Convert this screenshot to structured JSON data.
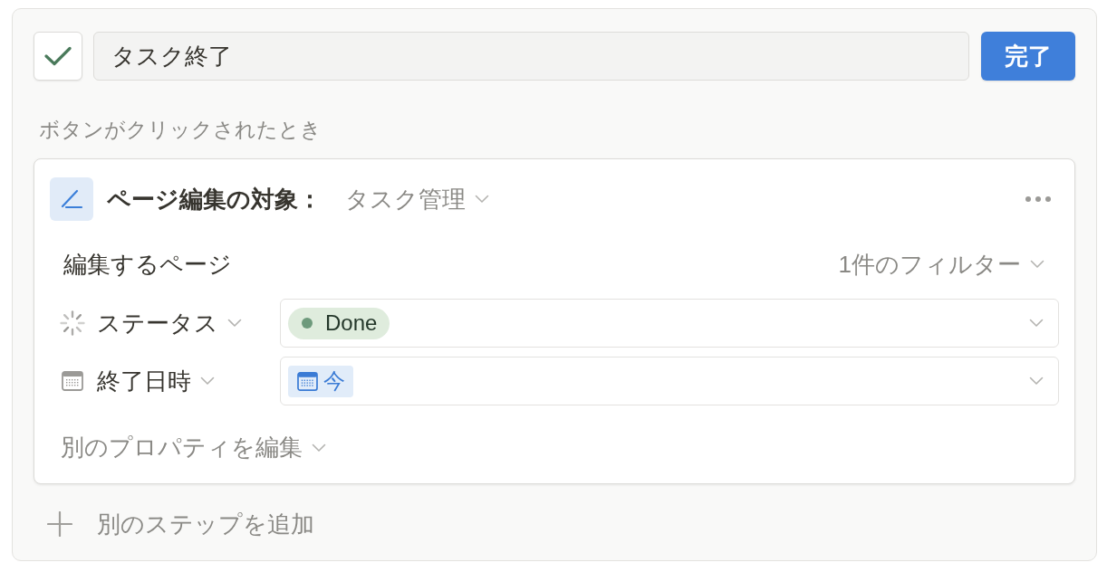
{
  "button_name": {
    "value": "タスク終了"
  },
  "done_button": {
    "label": "完了"
  },
  "trigger_label": "ボタンがクリックされたとき",
  "step": {
    "title": "ページ編集の対象：",
    "database": "タスク管理",
    "target_label": "編集するページ",
    "filter": "1件のフィルター",
    "properties": [
      {
        "kind": "status",
        "name": "ステータス",
        "value": "Done"
      },
      {
        "kind": "date",
        "name": "終了日時",
        "value": "今"
      }
    ],
    "edit_other": "別のプロパティを編集"
  },
  "add_step": "別のステップを追加"
}
